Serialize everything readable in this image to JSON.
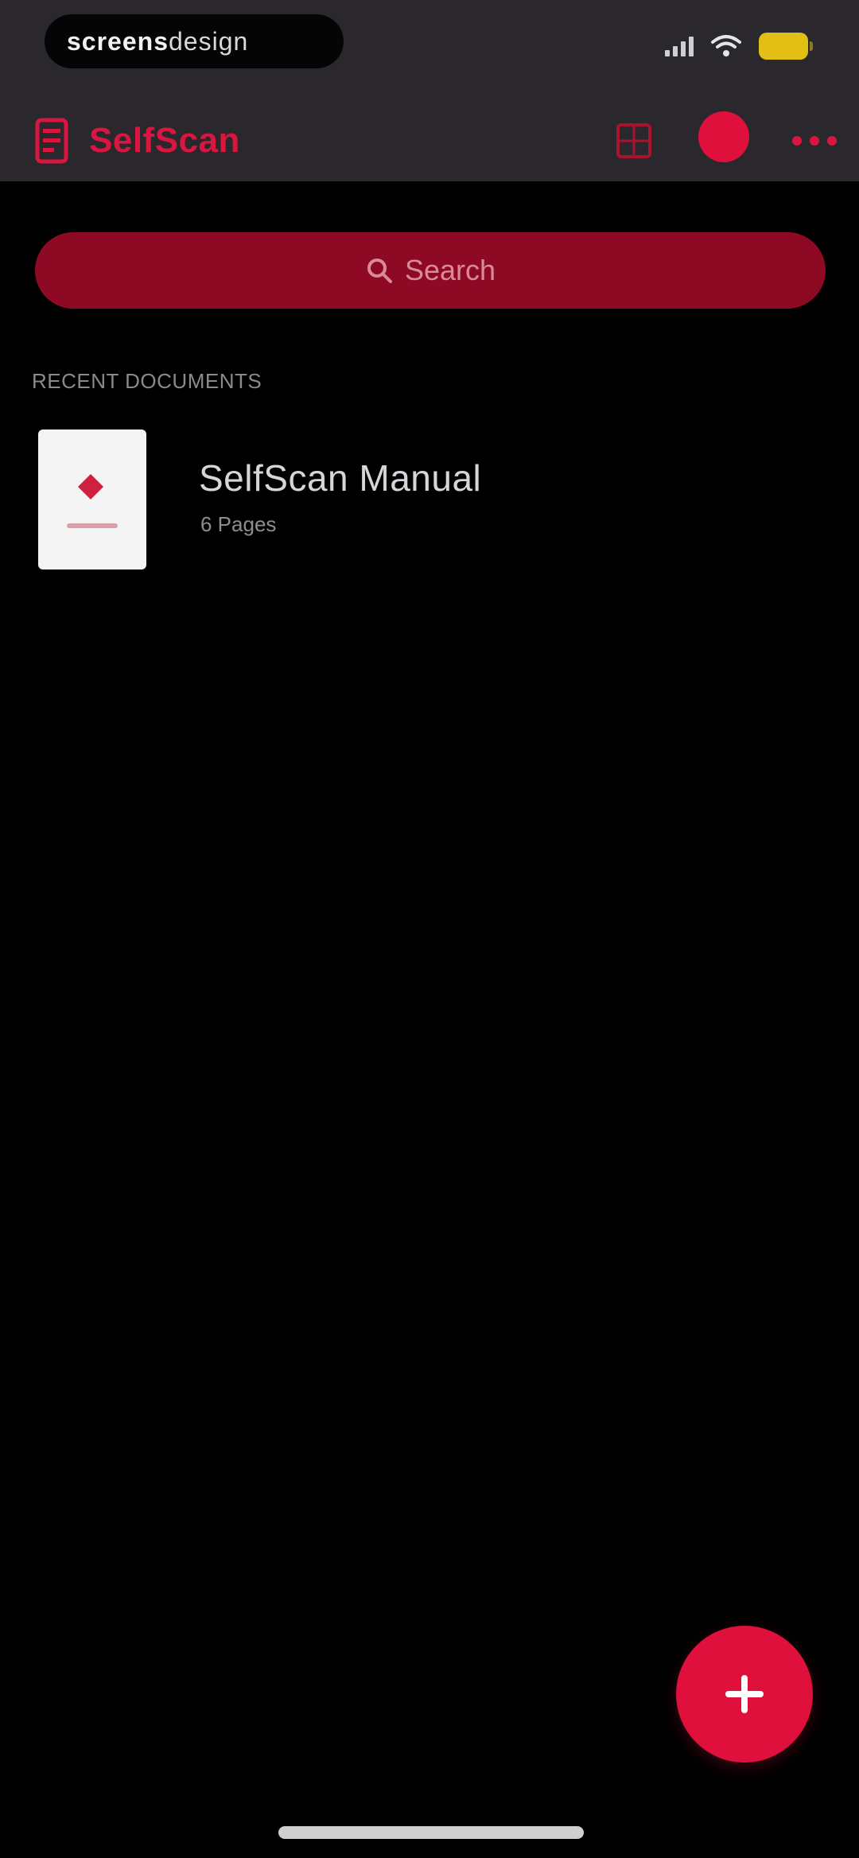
{
  "status_bar": {
    "recording_label_bold": "screens",
    "recording_label_thin": "design"
  },
  "app_bar": {
    "title": "SelfScan",
    "icons": {
      "logo": "document-scan-icon",
      "grid": "grid-view-icon",
      "profile": "profile-avatar",
      "more": "more-options-icon"
    }
  },
  "search": {
    "placeholder": "Search",
    "icon": "search-icon"
  },
  "documents": {
    "section_label": "RECENT DOCUMENTS",
    "items": [
      {
        "title": "SelfScan Manual",
        "subtitle": "6 Pages"
      }
    ]
  },
  "fab": {
    "icon": "plus-icon"
  },
  "colors": {
    "accent": "#E0103C",
    "search_background": "#8E0A24",
    "header_background": "#2A282D",
    "background": "#000000"
  }
}
